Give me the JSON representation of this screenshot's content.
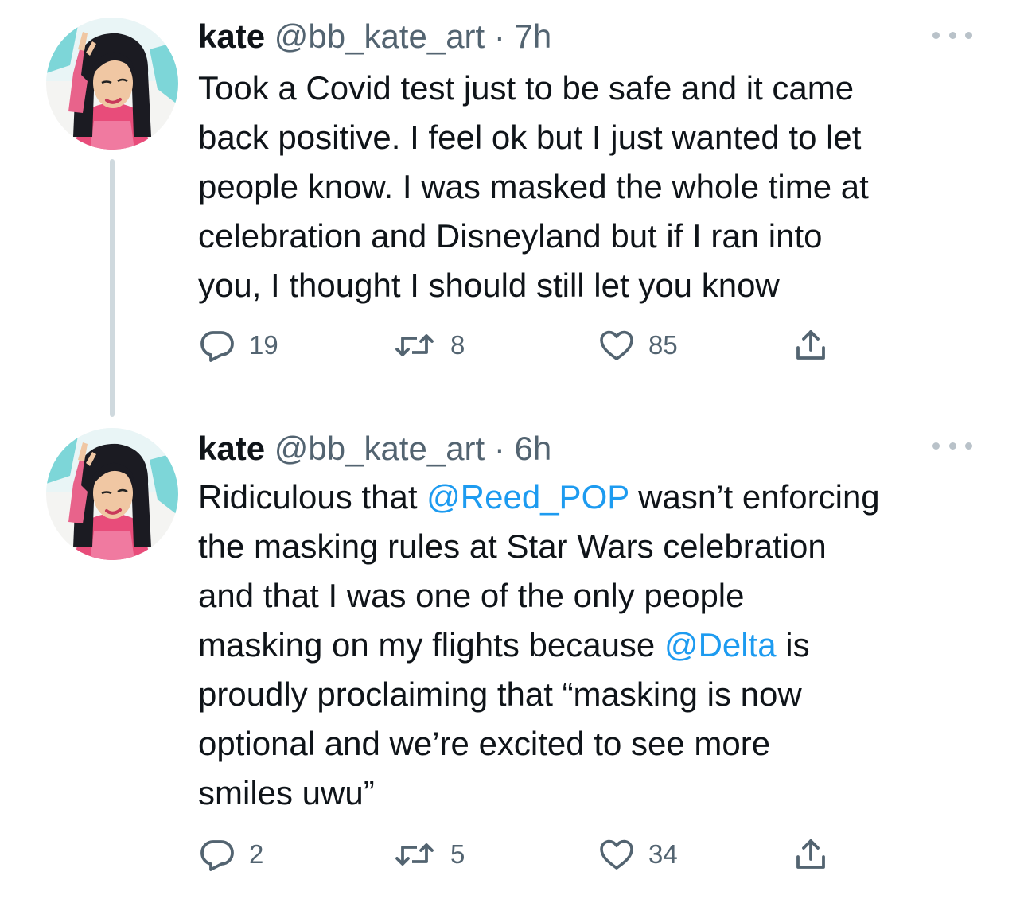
{
  "tweets": [
    {
      "display_name": "kate",
      "handle": "@bb_kate_art",
      "separator": "·",
      "time": "7h",
      "text_lines": [
        [
          {
            "t": "Took a Covid test just to be safe and it came"
          }
        ],
        [
          {
            "t": "back positive. I feel ok but I just wanted to let"
          }
        ],
        [
          {
            "t": "people know. I was masked the whole time at"
          }
        ],
        [
          {
            "t": "celebration and Disneyland but if I ran into"
          }
        ],
        [
          {
            "t": "you, I thought I should still let you know"
          }
        ]
      ],
      "replies": "19",
      "retweets": "8",
      "likes": "85"
    },
    {
      "display_name": "kate",
      "handle": "@bb_kate_art",
      "separator": "·",
      "time": "6h",
      "text_lines": [
        [
          {
            "t": "Ridiculous that "
          },
          {
            "t": "@Reed_POP",
            "mention": true
          },
          {
            "t": " wasn’t enforcing"
          }
        ],
        [
          {
            "t": "the masking rules at Star Wars celebration"
          }
        ],
        [
          {
            "t": "and that I was one of the only people"
          }
        ],
        [
          {
            "t": "masking on my flights because "
          },
          {
            "t": "@Delta",
            "mention": true
          },
          {
            "t": " is"
          }
        ],
        [
          {
            "t": "proudly proclaiming that “masking is now"
          }
        ],
        [
          {
            "t": "optional and we’re excited to see more"
          }
        ],
        [
          {
            "t": "smiles uwu”"
          }
        ]
      ],
      "replies": "2",
      "retweets": "5",
      "likes": "34"
    }
  ],
  "icons": {
    "reply": "reply-icon",
    "retweet": "retweet-icon",
    "like": "heart-icon",
    "share": "share-icon",
    "more": "more-icon"
  },
  "colors": {
    "text": "#0f1419",
    "secondary": "#536471",
    "mention": "#1d9bf0",
    "thread_line": "#cfd9de"
  }
}
